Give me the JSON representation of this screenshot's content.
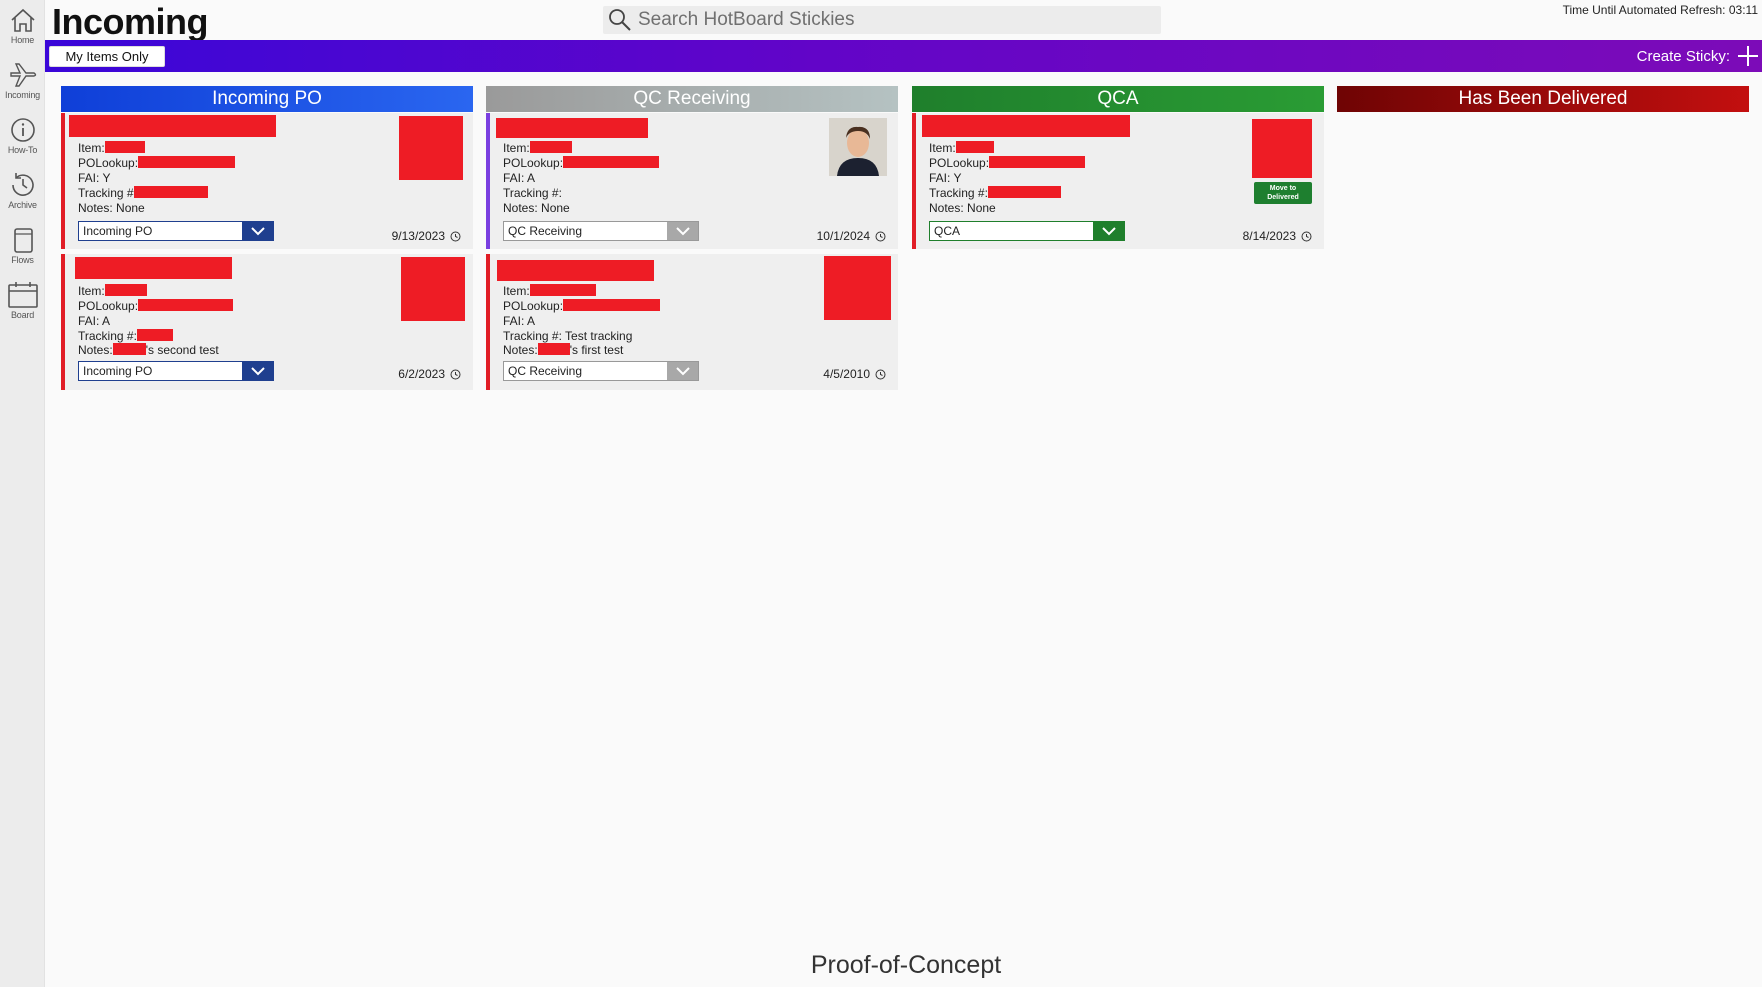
{
  "sidebar": {
    "items": [
      {
        "label": "Home",
        "icon": "home-icon"
      },
      {
        "label": "Incoming",
        "icon": "airplane-icon"
      },
      {
        "label": "How-To",
        "icon": "info-icon"
      },
      {
        "label": "Archive",
        "icon": "history-icon"
      },
      {
        "label": "Flows",
        "icon": "notebook-icon"
      },
      {
        "label": "Board",
        "icon": "calendar-icon"
      }
    ]
  },
  "header": {
    "title": "Incoming",
    "search_placeholder": "Search HotBoard Stickies",
    "refresh_label": "Time Until Automated Refresh: 03:11"
  },
  "toolbar": {
    "my_items_label": "My Items Only",
    "create_sticky_label": "Create Sticky:"
  },
  "columns": [
    {
      "title": "Incoming PO",
      "color": "#1549de",
      "cards": [
        {
          "item_label": "Item:",
          "po_label": "POLookup:",
          "fai": "FAI: Y",
          "tracking_label": "Tracking #",
          "tracking_value": "",
          "notes_label": "Notes:",
          "notes_value": " None",
          "status": "Incoming PO",
          "date": "9/13/2023",
          "accent": "#e11d26"
        },
        {
          "item_label": "Item:",
          "po_label": "POLookup:",
          "fai": "FAI: A",
          "tracking_label": "Tracking #:",
          "tracking_value": "",
          "notes_label": "Notes:",
          "notes_value": "'s second test",
          "status": "Incoming PO",
          "date": "6/2/2023",
          "accent": "#e11d26"
        }
      ]
    },
    {
      "title": "QC Receiving",
      "color": "#a3a3a3",
      "cards": [
        {
          "item_label": "Item:",
          "po_label": "POLookup:",
          "fai": "FAI: A",
          "tracking_label": "Tracking #:",
          "tracking_value": "",
          "notes_label": "Notes:",
          "notes_value": " None",
          "status": "QC Receiving",
          "date": "10/1/2024",
          "accent": "#7a3fe0"
        },
        {
          "item_label": "Item:",
          "po_label": "POLookup:",
          "fai": "FAI: A",
          "tracking_label": "Tracking #:",
          "tracking_value": " Test tracking",
          "notes_label": "Notes:",
          "notes_value": "'s first test",
          "status": "QC Receiving",
          "date": "4/5/2010",
          "accent": "#e11d26"
        }
      ]
    },
    {
      "title": "QCA",
      "color": "#228b2e",
      "cards": [
        {
          "item_label": "Item:",
          "po_label": "POLookup:",
          "fai": "FAI: Y",
          "tracking_label": "Tracking #:",
          "tracking_value": "",
          "notes_label": "Notes:",
          "notes_value": " None",
          "status": "QCA",
          "date": "8/14/2023",
          "accent": "#e11d26",
          "move_label": "Move to Delivered"
        }
      ]
    },
    {
      "title": "Has Been Delivered",
      "color": "#8b0a0a",
      "cards": []
    }
  ],
  "footer": {
    "text": "Proof-of-Concept"
  }
}
